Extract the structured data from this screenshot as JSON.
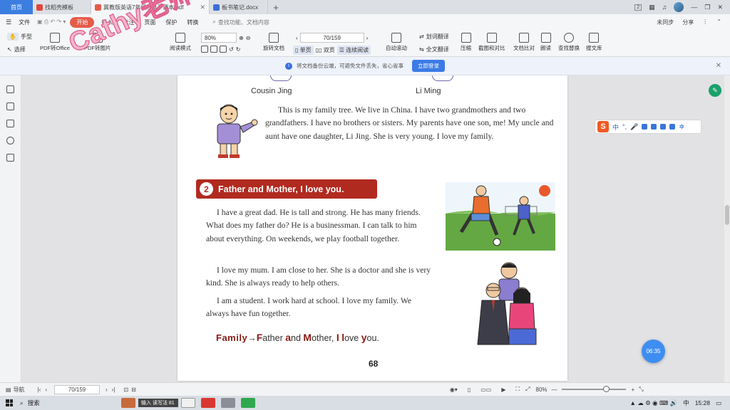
{
  "tabs": {
    "home": "首页",
    "items": [
      {
        "label": "找稻壳模板",
        "color": "#e0463a"
      },
      {
        "label": "冀教版英语7年级...电子课本.pdf",
        "color": "#e45c4a"
      },
      {
        "label": "板书笔记.docx",
        "color": "#3b6fd6"
      }
    ],
    "window_badge": "2",
    "controls": [
      "—",
      "❐",
      "✕"
    ]
  },
  "menu": {
    "items": [
      "文件",
      "开始",
      "插入",
      "批注",
      "页面",
      "保护",
      "转换"
    ],
    "active": "开始",
    "search": "查找功能、文档内容",
    "right": [
      "未同步",
      "分享"
    ]
  },
  "ribbon": {
    "hand": "手型",
    "select": "选择",
    "pdf_to_office": "PDF转Office",
    "pdf_to_image": "PDF转图片",
    "read_mode": "阅读模式",
    "zoom": "80%",
    "page_field": "70/159",
    "rotate": "旋转文档",
    "single": "单页",
    "double": "双页",
    "continuous": "连续阅读",
    "auto_scroll": "自动滚动",
    "translate_word": "划词翻译",
    "translate_full": "全文翻译",
    "compress": "压缩",
    "screenshot": "截图和对比",
    "compare": "文档比对",
    "tts": "朗读",
    "find_replace": "查找替换",
    "extract": "搜文库"
  },
  "notice": {
    "text": "将文档备份云端，可避免文件丢失，省心省事",
    "button": "立即登录"
  },
  "watermark": "Cathy老师",
  "page": {
    "caption_left": "Cousin Jing",
    "caption_right": "Li Ming",
    "family_tree_text": "This is my family tree. We live in China. I have two grandmothers and two grandfathers. I have no brothers or sisters. My parents have one son, me! My uncle and aunt have one daughter, Li Jing. She is very young. I love my family.",
    "section_number": "2",
    "section_title": "Father and Mother, I love you.",
    "p1": "I have a great dad. He is tall and strong. He has many friends. What does my father do? He is a businessman. I can talk to him about everything. On weekends, we play football together.",
    "p2": "I love my mum. I am close to her. She is a doctor and she is very kind. She is always ready to help others.",
    "p3": "I am a student. I work hard at school. I love my family. We always have fun together.",
    "acrostic": {
      "word": "Family",
      "arrow": "→",
      "parts": [
        {
          "cap": "F",
          "rest": "ather "
        },
        {
          "cap": "a",
          "rest": "nd "
        },
        {
          "cap": "M",
          "rest": "other, "
        },
        {
          "cap": "I",
          "rest": " "
        },
        {
          "cap": "l",
          "rest": "ove "
        },
        {
          "cap": "y",
          "rest": "ou."
        }
      ]
    },
    "page_number": "68"
  },
  "ime": {
    "logo": "S",
    "mode": "中"
  },
  "timer": "06:35",
  "statusbar": {
    "nav": "导航",
    "page_field": "70/159",
    "zoom": "80%"
  },
  "taskbar": {
    "search": "搜索",
    "ime_hint": "输入 读写法 81",
    "time": "15:28",
    "lang": "中"
  }
}
